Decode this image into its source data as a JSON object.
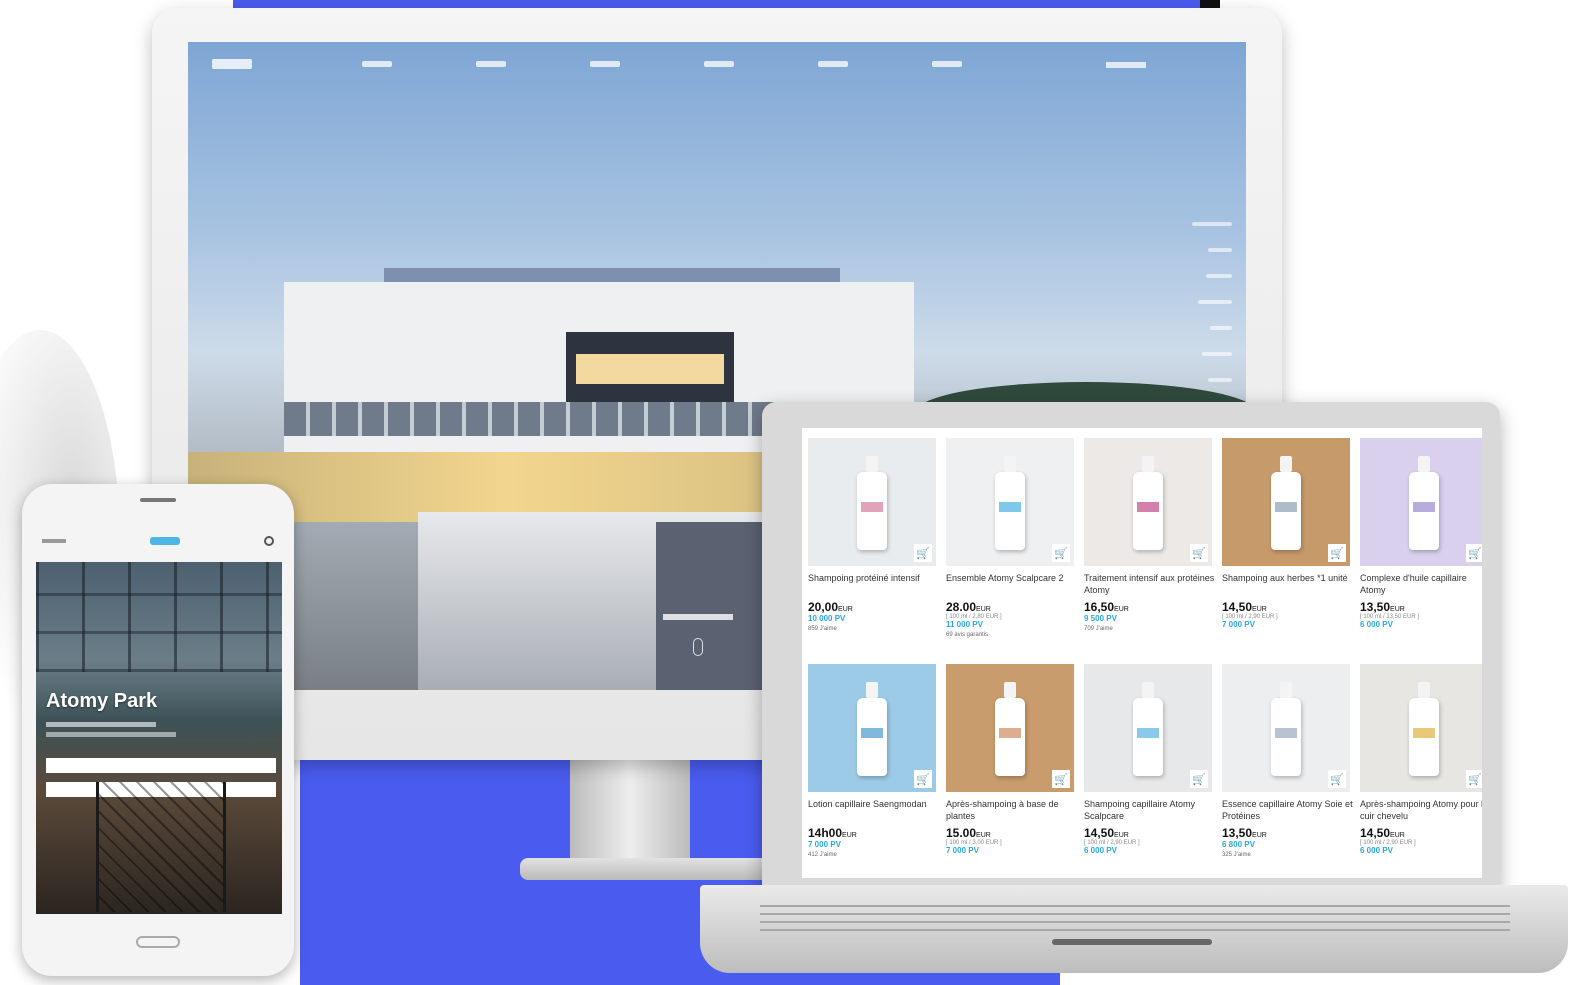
{
  "colors": {
    "accent_blue": "#4a5cf0",
    "pv_blue": "#29a8e0"
  },
  "phone": {
    "title": "Atomy Park",
    "buttons": [
      "",
      ""
    ]
  },
  "products": [
    {
      "name": "Shampoing protéiné intensif",
      "price": "20,00",
      "currency": "EUR",
      "unit": "",
      "pv": "10 000 PV",
      "reviews": "859 J'aime",
      "img_bg": "#e9ecef",
      "label": "#d47aa0"
    },
    {
      "name": "Ensemble Atomy Scalpcare 2",
      "price": "28.00",
      "currency": "EUR",
      "unit": "[ 100 ml / 2,80 EUR ]",
      "pv": "11 000 PV",
      "reviews": "69 avis garantis",
      "img_bg": "#eef0f2",
      "label": "#4ab0e0"
    },
    {
      "name": "Traitement intensif aux protéines Atomy",
      "price": "16,50",
      "currency": "EUR",
      "unit": "",
      "pv": "9 500 PV",
      "reviews": "709 J'aime",
      "img_bg": "#ece9e7",
      "label": "#c04a8a"
    },
    {
      "name": "Shampoing aux herbes *1 unité",
      "price": "14,50",
      "currency": "EUR",
      "unit": "[ 100 ml / 2,90 EUR ]",
      "pv": "7 000 PV",
      "reviews": "",
      "img_bg": "#c79a6a",
      "label": "#8aa0b0"
    },
    {
      "name": "Complexe d'huile capillaire Atomy",
      "price": "13,50",
      "currency": "EUR",
      "unit": "[ 100 ml / 13,50 EUR ]",
      "pv": "6 000 PV",
      "reviews": "",
      "img_bg": "#d9d0ee",
      "label": "#9a88d0"
    },
    {
      "name": "Lotion capillaire Saengmodan",
      "price": "14h00",
      "currency": "EUR",
      "unit": "",
      "pv": "7 000 PV",
      "reviews": "412 J'aime",
      "img_bg": "#9ccbe8",
      "label": "#4a9ad0"
    },
    {
      "name": "Après-shampoing à base de plantes",
      "price": "15.00",
      "currency": "EUR",
      "unit": "[ 100 ml / 3,00 EUR ]",
      "pv": "7 000 PV",
      "reviews": "",
      "img_bg": "#c89c6c",
      "label": "#d08a60"
    },
    {
      "name": "Shampoing capillaire Atomy Scalpcare",
      "price": "14,50",
      "currency": "EUR",
      "unit": "[ 100 ml / 2,90 EUR ]",
      "pv": "6 000 PV",
      "reviews": "",
      "img_bg": "#e6e8ea",
      "label": "#5ab0e0"
    },
    {
      "name": "Essence capillaire Atomy Soie et Protéines",
      "price": "13,50",
      "currency": "EUR",
      "unit": "",
      "pv": "6 800 PV",
      "reviews": "325 J'aime",
      "img_bg": "#eceeef",
      "label": "#9aa8c0"
    },
    {
      "name": "Après-shampoing Atomy pour le cuir chevelu",
      "price": "14,50",
      "currency": "EUR",
      "unit": "[ 100 ml / 2,90 EUR ]",
      "pv": "6 000 PV",
      "reviews": "",
      "img_bg": "#e8e6e2",
      "label": "#e0b040"
    }
  ]
}
